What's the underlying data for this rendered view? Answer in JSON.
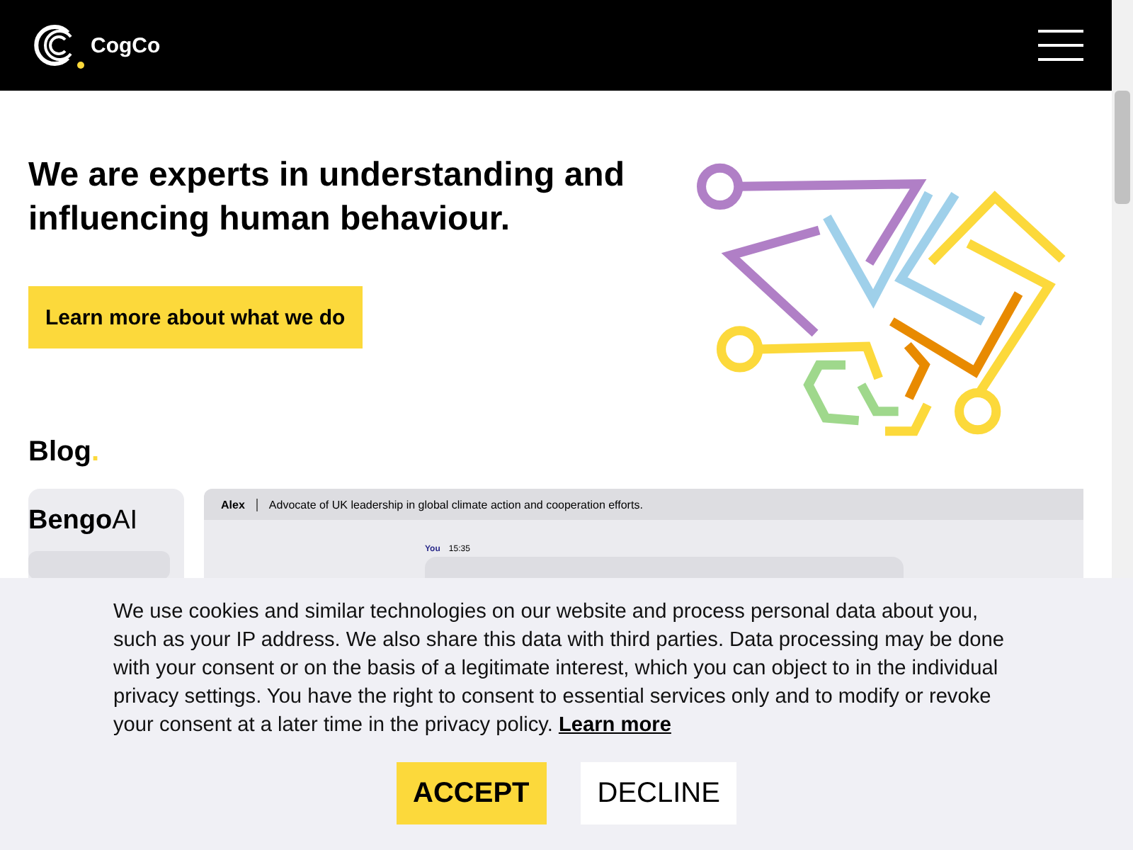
{
  "header": {
    "brand": "CogCo"
  },
  "hero": {
    "headline": "We are experts in understanding and influencing human behaviour.",
    "button": "Learn more about what we do"
  },
  "blog": {
    "heading": "Blog",
    "dot": ".",
    "preview": {
      "logo_bold": "Bengo",
      "logo_light": "AI",
      "speaker": "Alex",
      "speaker_bio": "Advocate of UK leadership in global climate action and cooperation efforts.",
      "sender": "You",
      "time": "15:35"
    }
  },
  "cookie_banner": {
    "text": "We use cookies and similar technologies on our website and process personal data about you, such as your IP address. We also share this data with third parties. Data processing may be done with your consent or on the basis of a legitimate interest, which you can object to in the individual privacy settings. You have the right to consent to essential services only and to modify or revoke your consent at a later time in the privacy policy.",
    "link": "Learn more",
    "buttons": [
      {
        "label": "ACCEPT",
        "kind": "primary"
      },
      {
        "label": "DECLINE",
        "kind": "secondary"
      }
    ]
  }
}
